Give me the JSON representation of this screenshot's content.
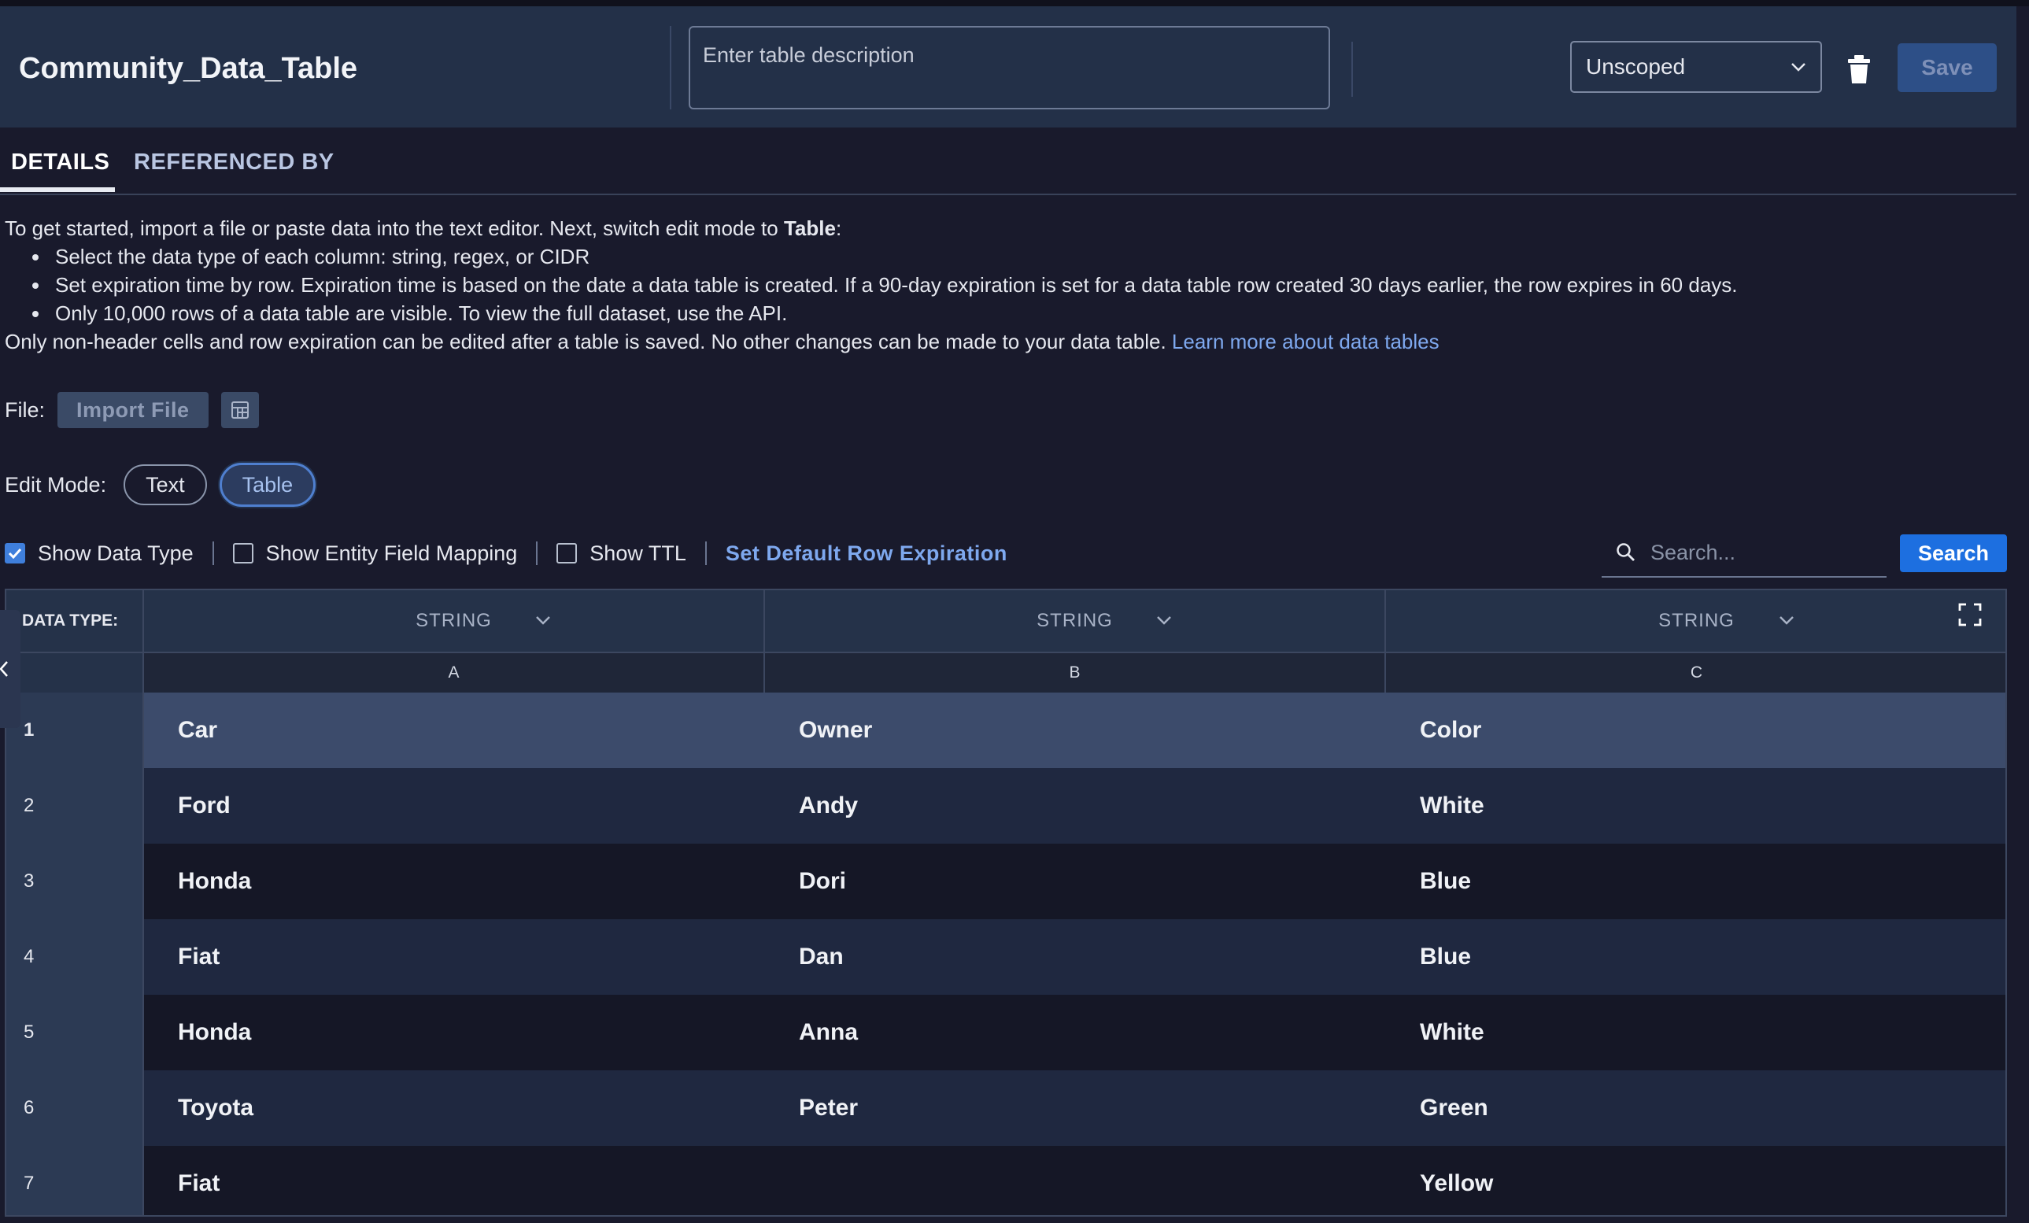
{
  "header": {
    "title": "Community_Data_Table",
    "description_placeholder": "Enter table description",
    "scope_value": "Unscoped",
    "save_label": "Save"
  },
  "tabs": [
    {
      "label": "DETAILS",
      "active": true
    },
    {
      "label": "REFERENCED BY",
      "active": false
    }
  ],
  "intro": {
    "lead": "To get started, import a file or paste data into the text editor. Next, switch edit mode to ",
    "lead_bold": "Table",
    "lead_end": ":",
    "bullets": [
      "Select the data type of each column: string, regex, or CIDR",
      "Set expiration time by row. Expiration time is based on the date a data table is created. If a 90-day expiration is set for a data table row created 30 days earlier, the row expires in 60 days.",
      "Only 10,000 rows of a data table are visible. To view the full dataset, use the API."
    ],
    "footer": "Only non-header cells and row expiration can be edited after a table is saved. No other changes can be made to your data table. ",
    "learn_more": "Learn more about data tables"
  },
  "file": {
    "label": "File:",
    "import_label": "Import File"
  },
  "edit_mode": {
    "label": "Edit Mode:",
    "options": [
      "Text",
      "Table"
    ],
    "selected": "Table"
  },
  "options": {
    "show_data_type": {
      "label": "Show Data Type",
      "checked": true
    },
    "show_entity_field_mapping": {
      "label": "Show Entity Field Mapping",
      "checked": false
    },
    "show_ttl": {
      "label": "Show TTL",
      "checked": false
    },
    "default_expiration_label": "Set Default Row Expiration"
  },
  "search": {
    "placeholder": "Search...",
    "button_label": "Search"
  },
  "table": {
    "data_type_label": "DATA TYPE:",
    "column_types": [
      "STRING",
      "STRING",
      "STRING"
    ],
    "column_letters": [
      "A",
      "B",
      "C"
    ],
    "rows": [
      {
        "num": "1",
        "cells": [
          "Car",
          "Owner",
          "Color"
        ]
      },
      {
        "num": "2",
        "cells": [
          "Ford",
          "Andy",
          "White"
        ]
      },
      {
        "num": "3",
        "cells": [
          "Honda",
          "Dori",
          "Blue"
        ]
      },
      {
        "num": "4",
        "cells": [
          "Fiat",
          "Dan",
          "Blue"
        ]
      },
      {
        "num": "5",
        "cells": [
          "Honda",
          "Anna",
          "White"
        ]
      },
      {
        "num": "6",
        "cells": [
          "Toyota",
          "Peter",
          "Green"
        ]
      },
      {
        "num": "7",
        "cells": [
          "Fiat",
          "",
          "Yellow"
        ]
      }
    ]
  },
  "colors": {
    "accent": "#1d6fe0",
    "link": "#7ea8ee",
    "header_bg": "#233048"
  }
}
